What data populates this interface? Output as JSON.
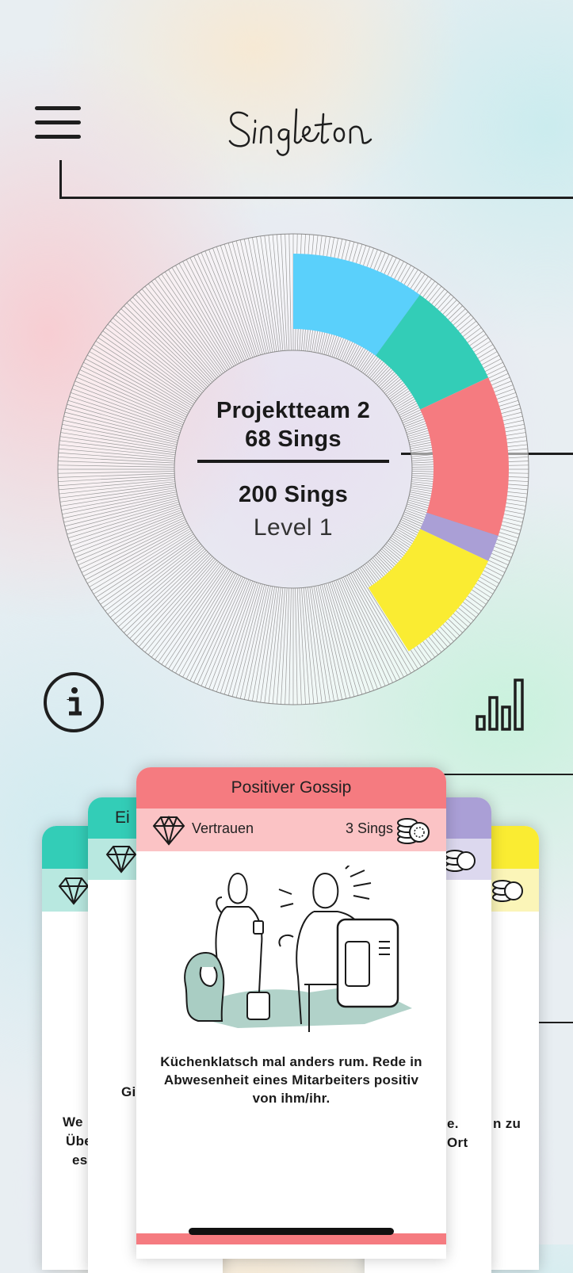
{
  "header": {
    "menu_icon": "hamburger-menu-icon",
    "logo_text": "Singleton"
  },
  "progress": {
    "team_name": "Projektteam 2",
    "current_sings": "68 Sings",
    "total_sings": "200 Sings",
    "level": "Level 1",
    "segments": [
      {
        "color": "#5ad0fb",
        "share": 0.1
      },
      {
        "color": "#33cdb7",
        "share": 0.08
      },
      {
        "color": "#f57b80",
        "share": 0.12
      },
      {
        "color": "#aa9fd6",
        "share": 0.02
      },
      {
        "color": "#faec32",
        "share": 0.09
      }
    ]
  },
  "toolbar": {
    "info_icon": "info-icon",
    "stats_icon": "bar-chart-icon"
  },
  "cards": {
    "main": {
      "title": "Positiver Gossip",
      "category": "Vertrauen",
      "category_icon": "diamond-icon",
      "cost": "3 Sings",
      "cost_icon": "coins-icon",
      "illustration": "office-chat-illustration",
      "description": "Küchenklatsch mal anders rum. Rede in Abwesenheit eines Mitarbeiters positiv von ihm/ihr.",
      "color": "#f57b80",
      "sub_color": "#fbc3c5"
    },
    "left_back": {
      "title_fragment": "Ei",
      "text_fragment": "Gi",
      "color": "#33cdb7"
    },
    "left_far": {
      "text_lines": [
        "We",
        "Übe",
        "es"
      ],
      "color": "#33cdb7"
    },
    "right_back": {
      "text_lines": [
        "e.",
        "Ort"
      ],
      "color": "#aa9fd6"
    },
    "right_far": {
      "text_fragment": "n zu",
      "color": "#faec32"
    }
  }
}
